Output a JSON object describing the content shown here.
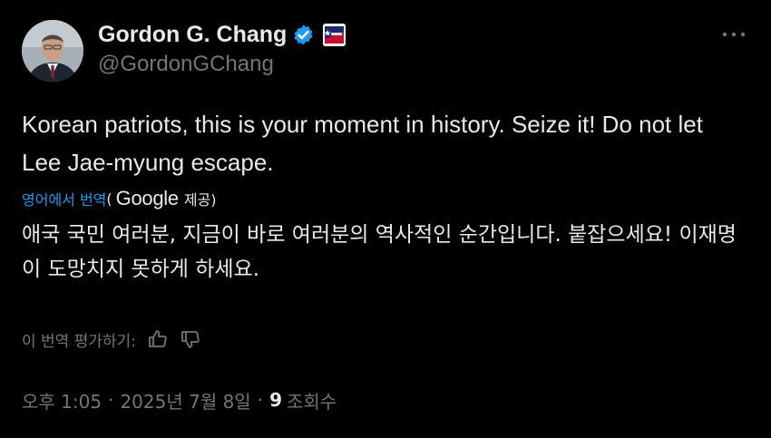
{
  "author": {
    "display_name": "Gordon G. Chang",
    "handle": "@GordonGChang",
    "verified_icon": "verified-badge-icon",
    "affiliation_badge_icon": "cpac-badge-icon"
  },
  "tweet": {
    "text": "Korean patriots, this is your moment in history. Seize it! Do not let Lee Jae-myung escape."
  },
  "translation": {
    "link_label": "영어에서 번역",
    "open_paren": "(",
    "provider": "Google",
    "suffix": "제공)",
    "text": "애국 국민 여러분, 지금이 바로 여러분의 역사적인 순간입니다. 붙잡으세요! 이재명이 도망치지 못하게 하세요."
  },
  "rating": {
    "label": "이 번역 평가하기:",
    "thumbs_up_icon": "thumbs-up-icon",
    "thumbs_down_icon": "thumbs-down-icon"
  },
  "meta": {
    "time": "오후 1:05",
    "separator": "·",
    "date": "2025년 7월 8일",
    "views_count": "9",
    "views_label": "조회수"
  },
  "colors": {
    "background": "#000000",
    "text": "#e7e9ea",
    "secondary": "#71767b",
    "link": "#1d9bf0"
  }
}
